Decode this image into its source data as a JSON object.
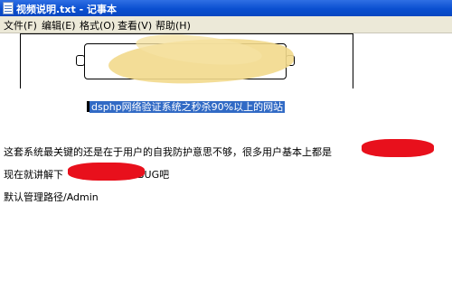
{
  "window": {
    "title": "视频说明.txt - 记事本"
  },
  "menu": {
    "items": [
      "文件(F)",
      "编辑(E)",
      "格式(O)",
      "查看(V)",
      "帮助(H)"
    ]
  },
  "content": {
    "selected_line": "dsphp网络验证系统之秒杀90%以上的网站",
    "line1": "这套系统最关键的还是在于用户的自我防护意思不够，很多用户基本上都是",
    "line2_start": "现在就讲解下",
    "line2_end": "BUG吧",
    "line3": "默认管理路径/Admin"
  }
}
